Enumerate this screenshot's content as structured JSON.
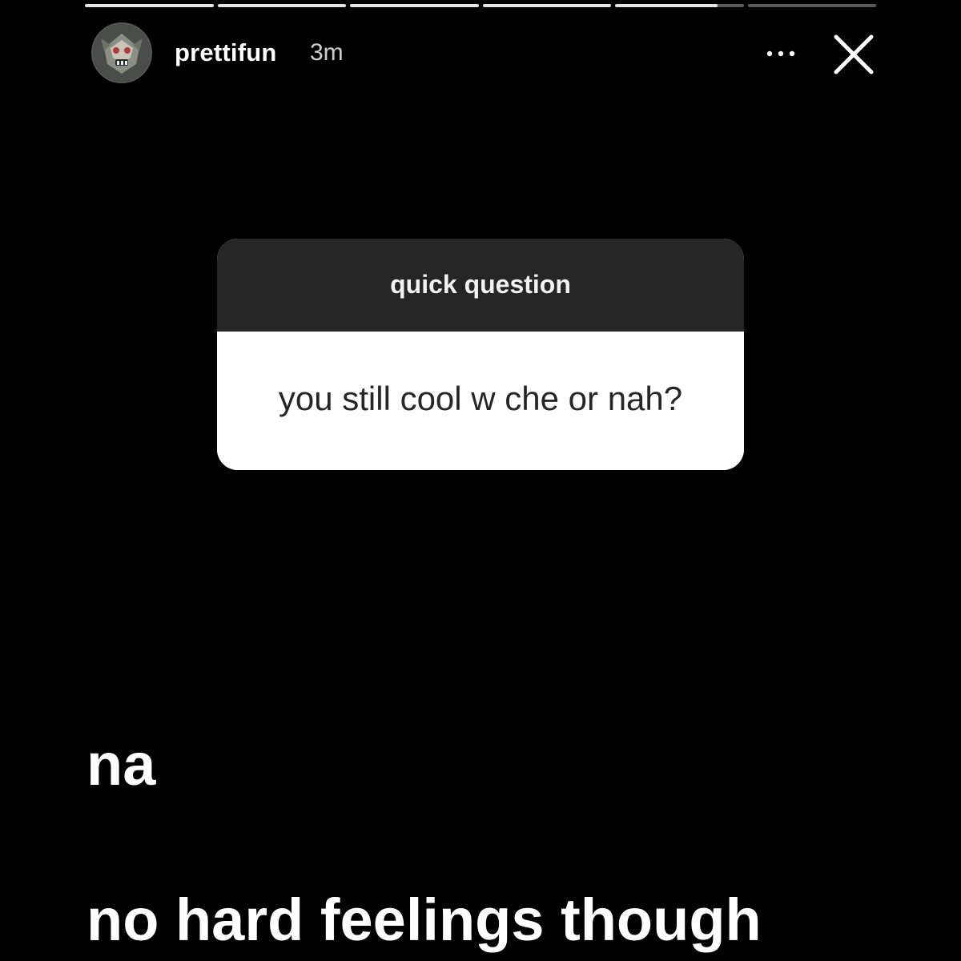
{
  "story": {
    "progress": {
      "segments": [
        1,
        1,
        1,
        1,
        0.8,
        0
      ],
      "segment_count": 6
    },
    "header": {
      "username": "prettifun",
      "timestamp": "3m",
      "more_icon": "more-horizontal-icon",
      "close_icon": "close-icon"
    },
    "question_sticker": {
      "title": "quick question",
      "question": "you still cool w che or nah?"
    },
    "reply": {
      "line1": "na",
      "line2": "no hard feelings though"
    }
  },
  "colors": {
    "background": "#000000",
    "sticker_header": "#262626",
    "sticker_body": "#ffffff",
    "text_primary": "#ffffff"
  }
}
